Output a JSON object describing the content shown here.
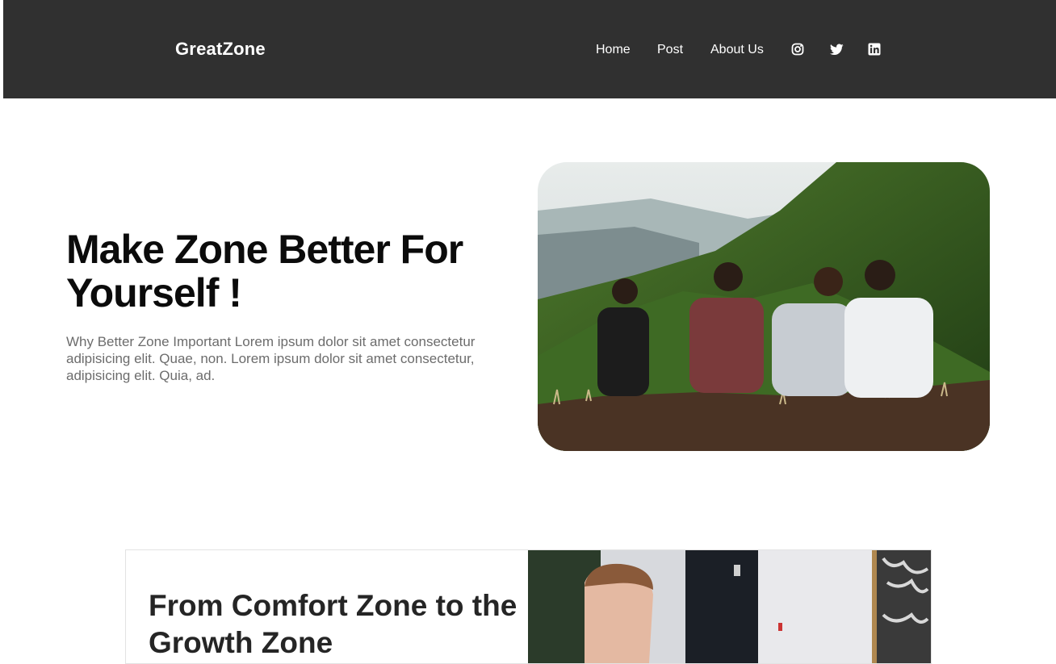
{
  "nav": {
    "brand": "GreatZone",
    "links": [
      {
        "label": "Home"
      },
      {
        "label": "Post"
      },
      {
        "label": "About Us"
      }
    ],
    "social_icons": [
      "instagram-icon",
      "twitter-icon",
      "linkedin-icon"
    ]
  },
  "hero": {
    "title": "Make Zone Better For Yourself !",
    "description": "Why Better Zone Important Lorem ipsum dolor sit amet consectetur adipisicing elit. Quae, non. Lorem ipsum dolor sit amet consectetur, adipisicing elit. Quia, ad."
  },
  "feature": {
    "title": "From Comfort Zone to the Growth Zone"
  },
  "colors": {
    "navbar_bg": "#303030",
    "title_text": "#0b0b0b",
    "body_text": "#6c6c6c"
  }
}
